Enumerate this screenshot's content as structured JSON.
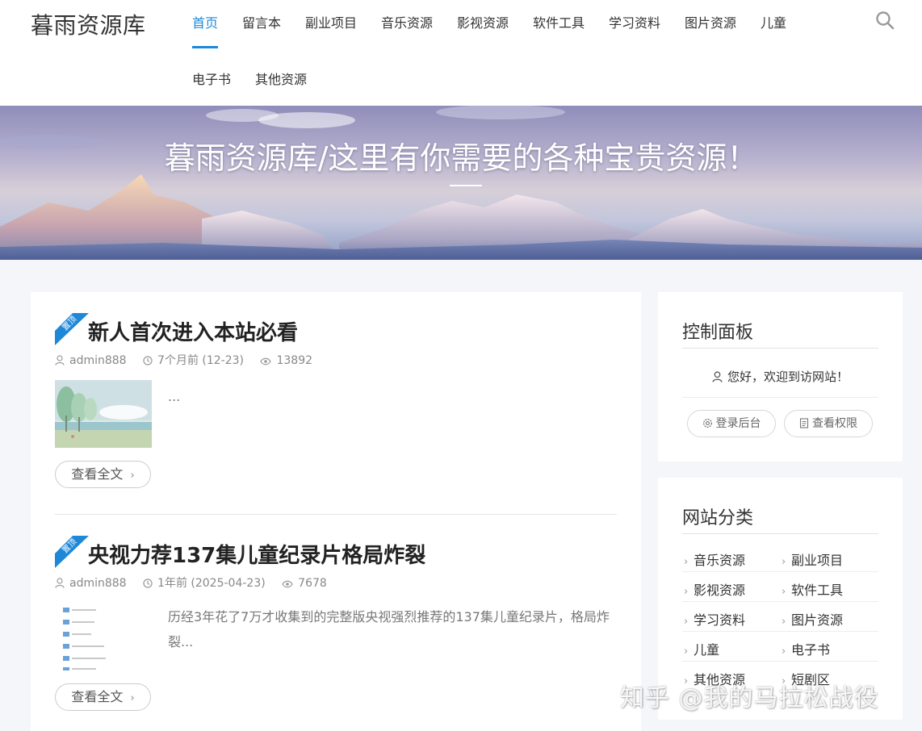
{
  "site": {
    "logo": "暮雨资源库"
  },
  "nav": {
    "items": [
      {
        "label": "首页",
        "active": true
      },
      {
        "label": "留言本"
      },
      {
        "label": "副业项目"
      },
      {
        "label": "音乐资源"
      },
      {
        "label": "影视资源"
      },
      {
        "label": "软件工具"
      },
      {
        "label": "学习资料"
      },
      {
        "label": "图片资源"
      },
      {
        "label": "儿童"
      },
      {
        "label": "电子书"
      },
      {
        "label": "其他资源"
      }
    ],
    "search_icon": "search-icon"
  },
  "banner": {
    "title": "暮雨资源库/这里有你需要的各种宝贵资源！"
  },
  "posts": [
    {
      "badge": "置顶",
      "title": "新人首次进入本站必看",
      "author": "admin888",
      "time": "7个月前 (12-23)",
      "views": "13892",
      "excerpt": "...",
      "readmore": "查看全文"
    },
    {
      "badge": "置顶",
      "title": "央视力荐137集儿童纪录片格局炸裂",
      "author": "admin888",
      "time": "1年前 (2025-04-23)",
      "views": "7678",
      "excerpt": "历经3年花了7万才收集到的完整版央视强烈推荐的137集儿童纪录片，格局炸裂...",
      "readmore": "查看全文"
    }
  ],
  "sidebar": {
    "control": {
      "title": "控制面板",
      "welcome": "您好，欢迎到访网站！",
      "login_label": "登录后台",
      "permission_label": "查看权限"
    },
    "categories": {
      "title": "网站分类",
      "items": [
        "音乐资源",
        "副业项目",
        "影视资源",
        "软件工具",
        "学习资料",
        "图片资源",
        "儿童",
        "电子书",
        "其他资源",
        "短剧区"
      ]
    }
  },
  "watermark": "知乎 @我的马拉松战役",
  "colors": {
    "accent": "#1e88d8",
    "badge": "#1e88d8"
  }
}
